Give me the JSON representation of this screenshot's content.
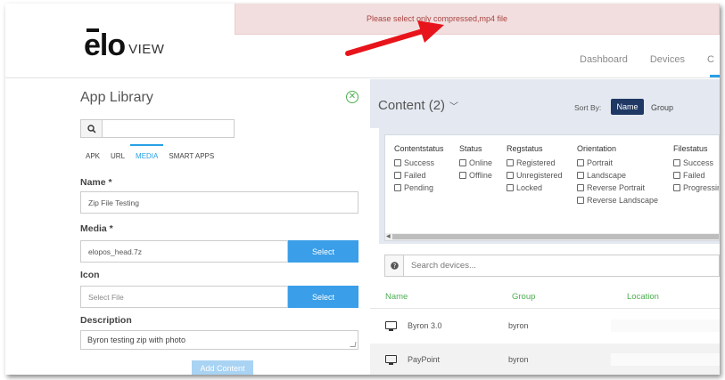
{
  "header": {
    "logo_elo": "elo",
    "logo_view": "VIEW",
    "alert": "Please select only compressed,mp4 file",
    "nav": [
      "Dashboard",
      "Devices",
      "C"
    ]
  },
  "app_library": {
    "title": "App Library",
    "tabs": [
      "APK",
      "URL",
      "MEDIA",
      "SMART APPS"
    ],
    "active_tab": "MEDIA",
    "name_label": "Name *",
    "name_value": "Zip File Testing",
    "media_label": "Media *",
    "media_value": "elopos_head.7z",
    "select_label": "Select",
    "icon_label": "Icon",
    "icon_placeholder": "Select File",
    "description_label": "Description",
    "description_value": "Byron testing zip with photo",
    "add_content_label": "Add Content"
  },
  "content": {
    "title": "Content (2)",
    "sort_by_label": "Sort By:",
    "sort_name": "Name",
    "sort_group": "Group",
    "filters": [
      {
        "title": "Contentstatus",
        "options": [
          "Success",
          "Failed",
          "Pending"
        ]
      },
      {
        "title": "Status",
        "options": [
          "Online",
          "Offline"
        ]
      },
      {
        "title": "Regstatus",
        "options": [
          "Registered",
          "Unregistered",
          "Locked"
        ]
      },
      {
        "title": "Orientation",
        "options": [
          "Portrait",
          "Landscape",
          "Reverse Portrait",
          "Reverse Landscape"
        ]
      },
      {
        "title": "Filestatus",
        "options": [
          "Success",
          "Failed",
          "Progressing"
        ]
      }
    ],
    "search_placeholder": "Search devices...",
    "columns": [
      "Name",
      "Group",
      "Location"
    ],
    "rows": [
      {
        "name": "Byron 3.0",
        "group": "byron"
      },
      {
        "name": "PayPoint",
        "group": "byron"
      }
    ]
  },
  "colors": {
    "accent": "#29a0e6",
    "select_button": "#3a9ee8",
    "sort_active": "#1f3864",
    "alert_bg": "#f2dede",
    "alert_text": "#a94442",
    "column_header": "#4caf50",
    "arrow": "#e8141b"
  }
}
